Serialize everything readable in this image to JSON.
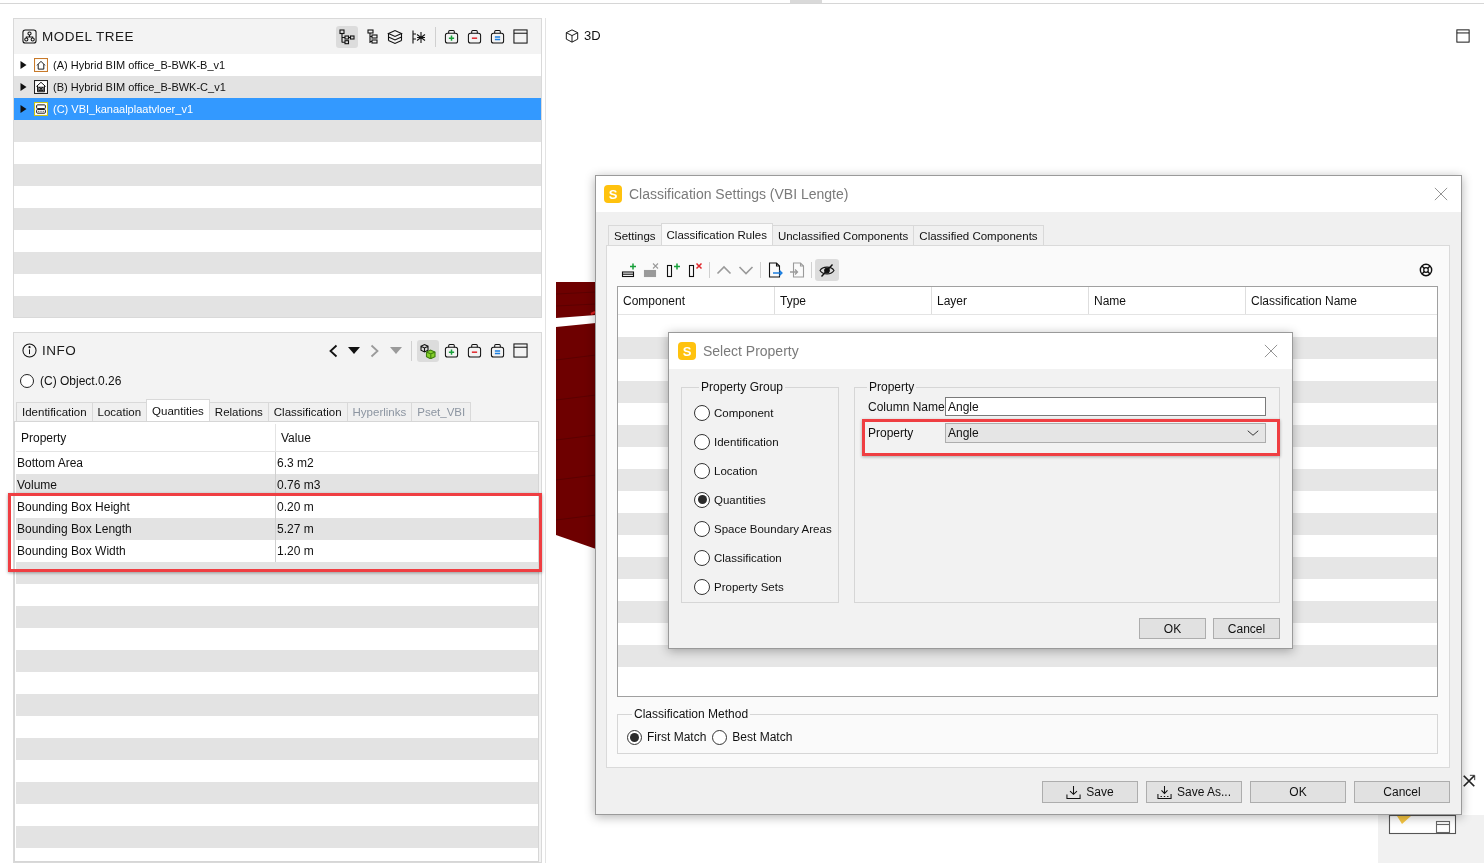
{
  "model_tree": {
    "title": "MODEL TREE",
    "view_modes": [
      {
        "selected": true
      },
      {
        "selected": false
      },
      {
        "selected": false
      },
      {
        "selected": false
      }
    ],
    "items": [
      {
        "label": "(A) Hybrid BIM office_B-BWK-B_v1",
        "kind": "house",
        "color": "#c87a2a",
        "expanded": false,
        "selected": false
      },
      {
        "label": "(B) Hybrid BIM office_B-BWK-C_v1",
        "kind": "depot",
        "color": "#222222",
        "expanded": false,
        "selected": false
      },
      {
        "label": "(C) VBI_kanaalplaatvloer_v1",
        "kind": "slab",
        "color": "#c8c41e",
        "expanded": false,
        "selected": true
      }
    ]
  },
  "info": {
    "title": "INFO",
    "history_nav": [
      {
        "disabled": false
      },
      {
        "disabled": false
      },
      {
        "disabled": true
      },
      {
        "disabled": true
      }
    ],
    "cube_toggle": {
      "on": true
    },
    "object": "(C) Object.0.26",
    "tabs": [
      {
        "label": "Identification",
        "selected": false,
        "disabled": false
      },
      {
        "label": "Location",
        "selected": false,
        "disabled": false
      },
      {
        "label": "Quantities",
        "selected": true,
        "disabled": false
      },
      {
        "label": "Relations",
        "selected": false,
        "disabled": false
      },
      {
        "label": "Classification",
        "selected": false,
        "disabled": false
      },
      {
        "label": "Hyperlinks",
        "selected": false,
        "disabled": true
      },
      {
        "label": "Pset_VBI",
        "selected": false,
        "disabled": true
      }
    ],
    "table": {
      "columns": [
        "Property",
        "Value"
      ],
      "rows": [
        {
          "property": "Bottom Area",
          "value": "6.3 m2",
          "highlighted": false
        },
        {
          "property": "Volume",
          "value": "0.76 m3",
          "highlighted": false
        },
        {
          "property": "Bounding Box Height",
          "value": "0.20 m",
          "highlighted": true
        },
        {
          "property": "Bounding Box Length",
          "value": "5.27 m",
          "highlighted": true
        },
        {
          "property": "Bounding Box Width",
          "value": "1.20 m",
          "highlighted": true
        }
      ]
    }
  },
  "view_3d": {
    "title": "3D"
  },
  "classification_dialog": {
    "logo": "S",
    "title": "Classification Settings (VBI Lengte)",
    "tabs": [
      {
        "label": "Settings",
        "selected": false
      },
      {
        "label": "Classification Rules",
        "selected": true
      },
      {
        "label": "Unclassified Components",
        "selected": false
      },
      {
        "label": "Classified Components",
        "selected": false
      }
    ],
    "toolbar": [
      {
        "kind": "addrow",
        "disabled": false
      },
      {
        "kind": "delrow",
        "disabled": true
      },
      {
        "kind": "addcol",
        "disabled": false
      },
      {
        "kind": "delcol",
        "disabled": false
      },
      {
        "kind": "up",
        "disabled": true
      },
      {
        "kind": "down",
        "disabled": true
      },
      {
        "kind": "export",
        "disabled": false
      },
      {
        "kind": "import",
        "disabled": true
      }
    ],
    "eye_toggle": {
      "on": true
    },
    "table": {
      "columns": [
        "Component",
        "Type",
        "Layer",
        "Name",
        "Classification Name"
      ]
    },
    "method": {
      "title": "Classification Method",
      "options": [
        {
          "label": "First Match",
          "selected": true
        },
        {
          "label": "Best Match",
          "selected": false
        }
      ]
    },
    "buttons": [
      {
        "kind": "save",
        "label": "Save"
      },
      {
        "kind": "saveas",
        "label": "Save As..."
      },
      {
        "kind": "plain",
        "label": "OK"
      },
      {
        "kind": "plain",
        "label": "Cancel"
      }
    ]
  },
  "select_property_dialog": {
    "logo": "S",
    "title": "Select Property",
    "group": {
      "title": "Property Group",
      "options": [
        {
          "label": "Component",
          "selected": false
        },
        {
          "label": "Identification",
          "selected": false
        },
        {
          "label": "Location",
          "selected": false
        },
        {
          "label": "Quantities",
          "selected": true
        },
        {
          "label": "Space Boundary Areas",
          "selected": false
        },
        {
          "label": "Classification",
          "selected": false
        },
        {
          "label": "Property Sets",
          "selected": false
        }
      ]
    },
    "property": {
      "title": "Property",
      "fields": [
        {
          "kind": "text",
          "label": "Column Name",
          "value": "Angle",
          "highlighted": false
        },
        {
          "kind": "dropdown",
          "label": "Property",
          "value": "Angle",
          "highlighted": true
        }
      ]
    },
    "buttons": [
      "OK",
      "Cancel"
    ]
  }
}
